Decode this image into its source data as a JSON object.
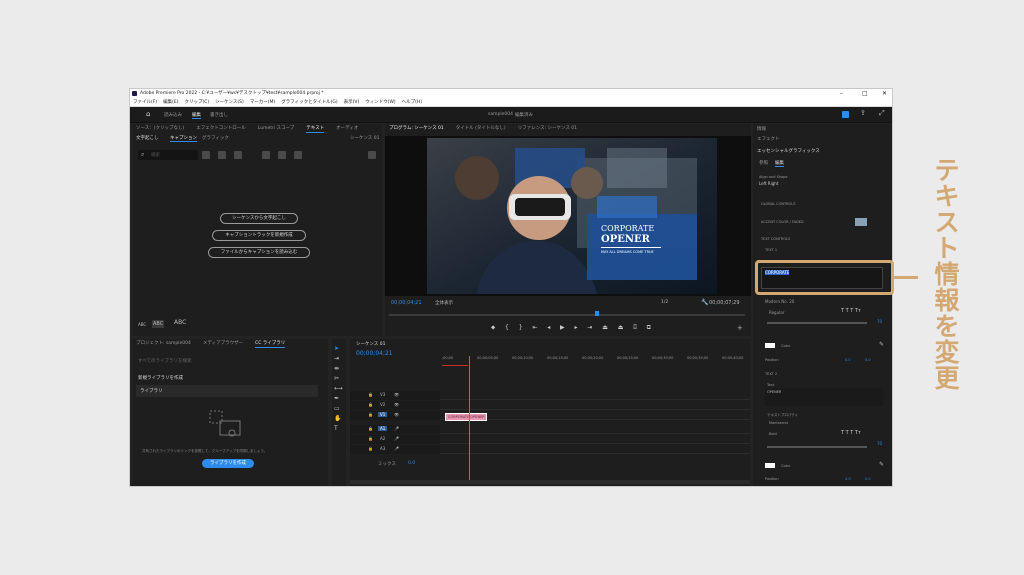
{
  "window": {
    "title": "Adobe Premiere Pro 2022 - C:¥ユーザー¥ws¥デスクトップ¥test¥sample004.prproj *"
  },
  "menu": [
    "ファイル(F)",
    "編集(E)",
    "クリップ(C)",
    "シーケンス(S)",
    "マーカー(M)",
    "グラフィックとタイトル(G)",
    "表示(V)",
    "ウィンドウ(W)",
    "ヘルプ(H)"
  ],
  "workspace": {
    "tabs": [
      "読み込み",
      "編集",
      "書き出し"
    ],
    "project_name": "sample004",
    "edited": "編集済み"
  },
  "left_panel": {
    "tabs": [
      "ソース：(クリップなし)",
      "エフェクトコントロール",
      "Lumetri スコープ",
      "テキスト",
      "オーディオ"
    ],
    "subtabs": [
      "文字起こし",
      "キャプション",
      "グラフィック"
    ],
    "sequence_label": "シーケンス 01",
    "search_placeholder": "検索",
    "buttons": [
      "シーケンスから文字起こし",
      "キャプショントラックを新規作成",
      "ファイルからキャプションを読み込む"
    ],
    "abc_labels": [
      "ABC",
      "ABC",
      "ABC"
    ]
  },
  "program": {
    "tabs": [
      "プログラム: シーケンス 01",
      "タイトル (タイトルなし)",
      "リファレンス: シーケンス 01"
    ],
    "overlay_title_1": "CORPORATE",
    "overlay_title_2": "OPENER",
    "overlay_sub": "MAY ALL DREAMS COME TRUE",
    "timecode": "00;00;04;21",
    "fit": "全体表示",
    "quality": "1/2",
    "duration": "00;00;07;29"
  },
  "project_panel": {
    "tabs": [
      "プロジェクト: sample004",
      "メディアブラウザー",
      "CC ライブラリ"
    ],
    "search_placeholder": "すべてのライブラリを検索",
    "new_library": "新規ライブラリを作成",
    "library": "ライブラリ",
    "empty_msg": "共有されたライブラリのリンクを参照して、グループアップを同期しましょう。",
    "create_button": "ライブラリを作成"
  },
  "timeline": {
    "tab": "シーケンス 01",
    "timecode": "00;00;04;21",
    "ruler": [
      ";00;00",
      "00;00;05;00",
      "00;00;10;00",
      "00;00;15;00",
      "00;00;20;00",
      "00;00;25;00",
      "00;00;30;00",
      "00;00;35;00",
      "00;00;40;00"
    ],
    "tracks_video": [
      "V3",
      "V2",
      "V1"
    ],
    "tracks_audio": [
      "A1",
      "A2",
      "A3"
    ],
    "mix_label": "ミックス",
    "mix_value": "0.0",
    "clip_label": "CORPORATE OPENER"
  },
  "right_panel": {
    "tabs": [
      "情報",
      "エフェクト"
    ],
    "title": "エッセンシャルグラフィックス",
    "subtabs": [
      "参照",
      "編集"
    ],
    "align_label": "Align and Shape",
    "align_value": "Left Right",
    "groups": [
      "GLOBAL CONTROLS",
      "ACCENT COLOR / FADED",
      "TEXT CONTROLS",
      "TEXT 1"
    ],
    "text1_value": "CORPORATE",
    "font1": "Modern No. 20",
    "style1": "Regular",
    "size1": "70",
    "color_label": "Color",
    "position_label": "Position",
    "pos_x": "0.0",
    "pos_y": "0.0",
    "text2_group": "TEXT 2",
    "text2_label": "Text",
    "text2_value": "OPENER",
    "text_prop_label": "テキストプロパティ",
    "font2": "Montserrat",
    "style2": "Bold",
    "size2": "70"
  },
  "annotation": {
    "text": "テキスト情報を変更",
    "color": "#d3a873"
  }
}
